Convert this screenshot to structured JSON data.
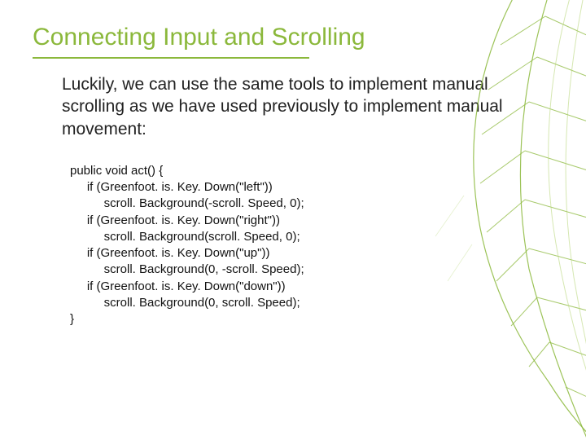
{
  "slide": {
    "title": "Connecting Input and Scrolling",
    "body": "Luckily, we can use the same tools to implement manual scrolling as we have used previously to implement manual movement:",
    "code": "public void act() {\n     if (Greenfoot. is. Key. Down(\"left\"))\n          scroll. Background(-scroll. Speed, 0);\n     if (Greenfoot. is. Key. Down(\"right\"))\n          scroll. Background(scroll. Speed, 0);\n     if (Greenfoot. is. Key. Down(\"up\"))\n          scroll. Background(0, -scroll. Speed);\n     if (Greenfoot. is. Key. Down(\"down\"))\n          scroll. Background(0, scroll. Speed);\n}"
  }
}
